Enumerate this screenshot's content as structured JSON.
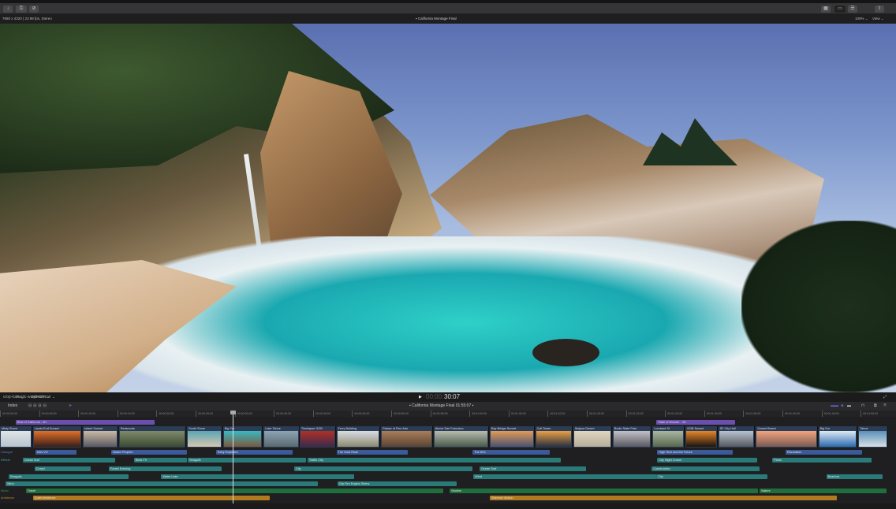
{
  "toolbar": {
    "import_icon": "download-icon",
    "keywords_icon": "key-icon",
    "bg_tasks_icon": "checkmark-circle-icon",
    "right_icons": [
      "browser-grid-icon",
      "timeline-icon",
      "inspector-icon",
      "share-icon"
    ]
  },
  "viewer_info": {
    "format": "7680 x 4320 | 23.98 fps, Stereo",
    "project": "California Montage Final",
    "zoom": "100% ⌄",
    "view": "View ⌄"
  },
  "controls": {
    "timecode_dim": "00:00:",
    "timecode": "30:07",
    "play": "▶",
    "tools": [
      "crop-icon ⌄",
      "magic-wand-icon ⌄",
      "speed-icon ⌄"
    ]
  },
  "timeline_bar": {
    "index": "Index",
    "project": "California Montage Final",
    "duration": "01:55:07"
  },
  "ruler": [
    "00:00:00:00",
    "00:00:05:00",
    "00:00:10:00",
    "00:00:15:00",
    "00:00:20:00",
    "00:00:25:00",
    "00:00:30:00",
    "00:00:35:00",
    "00:00:40:00",
    "00:00:45:00",
    "00:00:50:00",
    "00:00:55:00",
    "00:01:00:00",
    "00:01:05:00",
    "00:01:10:00",
    "00:01:15:00",
    "00:01:20:00",
    "00:01:25:00",
    "00:01:30:00",
    "00:01:35:00",
    "00:01:40:00",
    "00:01:45:00",
    "00:01:50:00"
  ],
  "titles": [
    {
      "name": "Best of California - 3D",
      "start": 2,
      "end": 19.8
    },
    {
      "name": "State of Wonder - 3D",
      "start": 83.9,
      "end": 94
    }
  ],
  "clips": [
    {
      "name": "Misty Shore",
      "start": 0,
      "end": 4.1,
      "c": [
        "#dfe4e8",
        "#b8c3cc"
      ]
    },
    {
      "name": "Lands End Sunset",
      "start": 4.2,
      "end": 10.5,
      "c": [
        "#e0702a",
        "#3a1e18"
      ]
    },
    {
      "name": "Island Sunset",
      "start": 10.6,
      "end": 15.1,
      "c": [
        "#c9b9a6",
        "#5b5a60"
      ]
    },
    {
      "name": "Redwoods",
      "start": 15.2,
      "end": 23.8,
      "c": [
        "#7e8a6a",
        "#3c4a33"
      ]
    },
    {
      "name": "South Shore",
      "start": 23.9,
      "end": 28.4,
      "c": [
        "#5aa6b4",
        "#d7c6b0"
      ]
    },
    {
      "name": "Big Sur",
      "start": 28.5,
      "end": 33.6,
      "c": [
        "#3ab8c2",
        "#7a5a3e"
      ]
    },
    {
      "name": "Lake Tahoe",
      "start": 33.7,
      "end": 38.3,
      "c": [
        "#8da2b4",
        "#5a6a6e"
      ]
    },
    {
      "name": "Timelapse GGB",
      "start": 38.3,
      "end": 42.9,
      "c": [
        "#b03028",
        "#3b2b4a"
      ]
    },
    {
      "name": "Ferry Building",
      "start": 43,
      "end": 48.6,
      "c": [
        "#d8dde4",
        "#8c8a70"
      ]
    },
    {
      "name": "Palace of Fine Arts",
      "start": 48.7,
      "end": 55.3,
      "c": [
        "#a87e5a",
        "#5a4432"
      ]
    },
    {
      "name": "Above San Francisco",
      "start": 55.4,
      "end": 62.5,
      "c": [
        "#b7bcae",
        "#4a5a4c"
      ]
    },
    {
      "name": "Bay Bridge Sunset",
      "start": 62.6,
      "end": 68.3,
      "c": [
        "#e39a58",
        "#4a5270"
      ]
    },
    {
      "name": "Coit Tower",
      "start": 68.4,
      "end": 73.2,
      "c": [
        "#e9a045",
        "#2a3040"
      ]
    },
    {
      "name": "Mojave Desert",
      "start": 73.3,
      "end": 78.2,
      "c": [
        "#ded5c2",
        "#b8ae98"
      ]
    },
    {
      "name": "Bodie State Park",
      "start": 78.3,
      "end": 83.3,
      "c": [
        "#c2c0c8",
        "#5a5860"
      ]
    },
    {
      "name": "Lombard St",
      "start": 83.4,
      "end": 87.5,
      "c": [
        "#a9b6a0",
        "#59674f"
      ]
    },
    {
      "name": "GGB Sunset",
      "start": 87.6,
      "end": 91.7,
      "c": [
        "#e8862a",
        "#1a1410"
      ]
    },
    {
      "name": "SF City Hall",
      "start": 91.8,
      "end": 96.5,
      "c": [
        "#b8c2d0",
        "#555a60"
      ]
    },
    {
      "name": "Sunset Beach",
      "start": 96.6,
      "end": 104.5,
      "c": [
        "#f2a480",
        "#7a5a50"
      ]
    },
    {
      "name": "Big Sur",
      "start": 104.6,
      "end": 109.6,
      "c": [
        "#dfeaf2",
        "#2a6ab0"
      ]
    },
    {
      "name": "Tahoe",
      "start": 109.7,
      "end": 113.5,
      "c": [
        "#5a90b8",
        "#d8e0e6"
      ]
    }
  ],
  "lanes": [
    {
      "label": "Dialogue",
      "color": "#3a5a9a",
      "text": "#5a78c0",
      "bars": [
        [
          "Intro VO",
          4.5,
          9.8
        ],
        [
          "Native Peoples",
          14.2,
          23.9
        ],
        [
          "Early Explorers",
          27.6,
          37.4
        ],
        [
          "The Gold Rush",
          43,
          52.1
        ],
        [
          "The 60's",
          60.4,
          70.3
        ],
        [
          "High Tech and the Future",
          84,
          93.7
        ],
        [
          "Recreation",
          100.4,
          110.2
        ]
      ]
    },
    {
      "label": "Effects",
      "color": "#2a7a7a",
      "text": "#4aa0a0",
      "bars": [
        [
          "Ocean Surf",
          2.9,
          14.7
        ],
        [
          "Birds FX",
          17.1,
          23.9
        ],
        [
          "Seagulls",
          24,
          39.1
        ],
        [
          "Traffic City",
          39.3,
          71.7
        ],
        [
          "City Night Crowd",
          84,
          96.8
        ],
        [
          "Parks",
          98.7,
          111.4
        ]
      ]
    },
    {
      "label": "",
      "color": "#2a7a7a",
      "text": "",
      "bars": [
        [
          "Crowd",
          4.4,
          11.6
        ],
        [
          "Forest Evening",
          13.9,
          28.3
        ],
        [
          "City",
          37.6,
          60.4
        ],
        [
          "Ocean Surf",
          61.3,
          74.9
        ],
        [
          "Construction",
          83.3,
          97.1
        ]
      ]
    },
    {
      "label": "",
      "color": "#2a7a7a",
      "text": "",
      "bars": [
        [
          "Seagulls",
          1.1,
          16.4
        ],
        [
          "Water Lake",
          20.6,
          45.3
        ],
        [
          "Wind",
          60.5,
          83.9
        ],
        [
          "City",
          83.9,
          98.1
        ],
        [
          "Beaches",
          105.6,
          112.8
        ]
      ]
    },
    {
      "label": "",
      "color": "#2a7a7a",
      "text": "",
      "bars": [
        [
          "Wind",
          0.7,
          40.6
        ],
        [
          "City Fire Engine Sirens",
          43.1,
          58.3
        ],
        [
          "",
          57,
          58.4
        ]
      ]
    },
    {
      "label": "Music",
      "color": "#1f6e3e",
      "text": "#3a9a5a",
      "bars": [
        [
          "Travel",
          3.3,
          56.7
        ],
        [
          "Modern",
          57.5,
          96.9
        ],
        [
          "Nature",
          97.1,
          113.3
        ]
      ]
    },
    {
      "label": "Ambience",
      "color": "#b07a20",
      "text": "#c08a30",
      "bars": [
        [
          "Quiet Ambience",
          4.2,
          34.5
        ],
        [
          "Shimmer Motion",
          62.6,
          107
        ]
      ]
    }
  ]
}
